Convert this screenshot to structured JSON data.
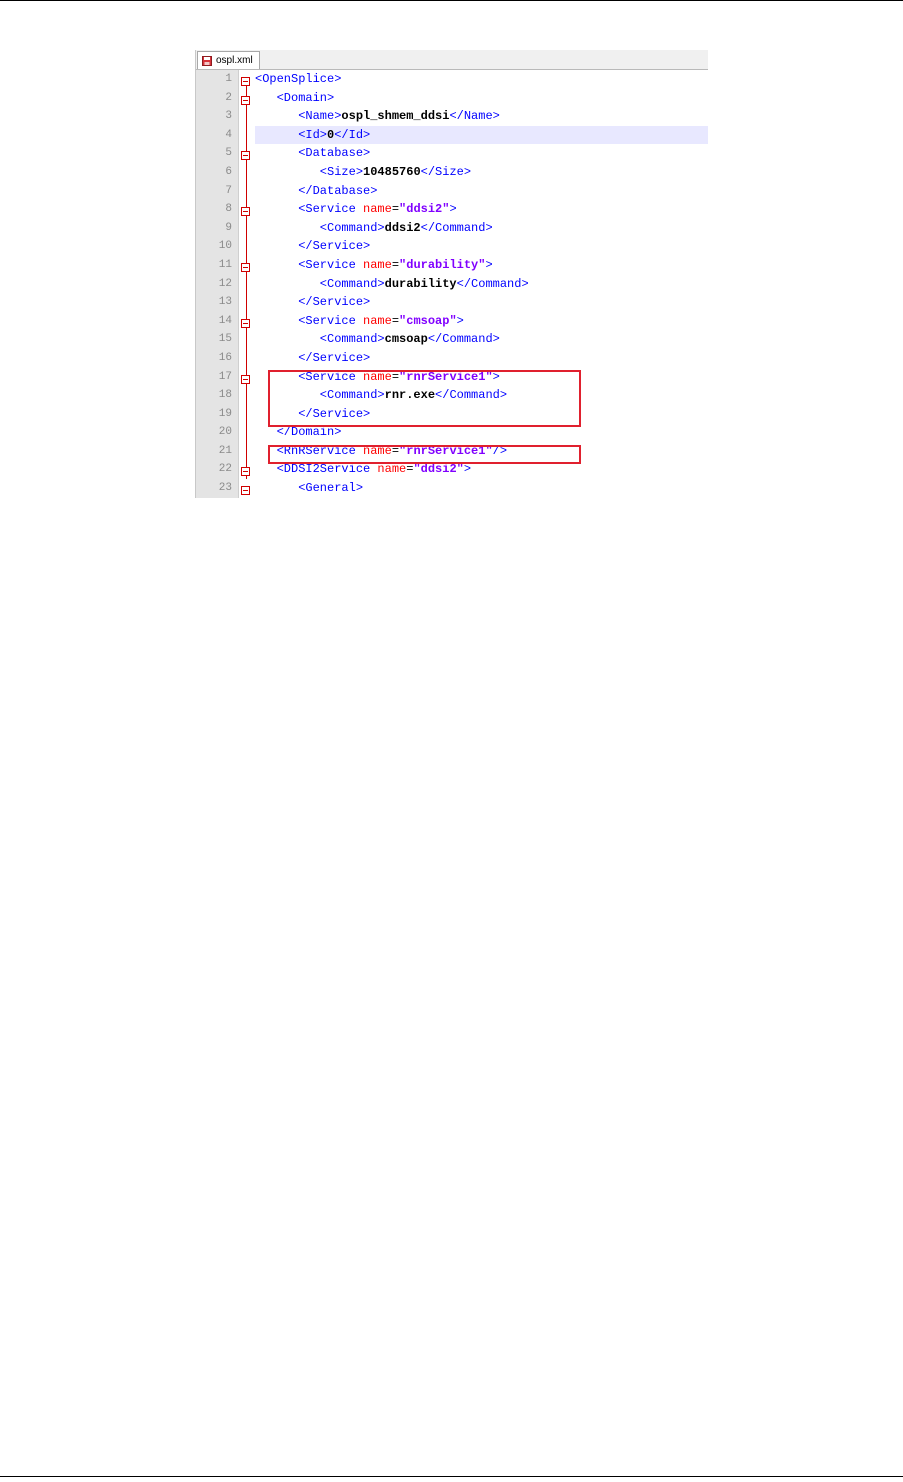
{
  "tab": {
    "filename": "ospl.xml",
    "icon": "save-icon"
  },
  "lines": [
    {
      "num": "1",
      "parts": [
        [
          "tag",
          "<OpenSplice>"
        ]
      ]
    },
    {
      "num": "2",
      "parts": [
        [
          "tag",
          "   <Domain>"
        ]
      ]
    },
    {
      "num": "3",
      "parts": [
        [
          "tag",
          "      <Name>"
        ],
        [
          "txt",
          "ospl_shmem_ddsi"
        ],
        [
          "tag",
          "</Name>"
        ]
      ]
    },
    {
      "num": "4",
      "parts": [
        [
          "tag",
          "      <Id>"
        ],
        [
          "txt",
          "0"
        ],
        [
          "tag",
          "</Id>"
        ]
      ]
    },
    {
      "num": "5",
      "parts": [
        [
          "tag",
          "      <Database>"
        ]
      ]
    },
    {
      "num": "6",
      "parts": [
        [
          "tag",
          "         <Size>"
        ],
        [
          "txt",
          "10485760"
        ],
        [
          "tag",
          "</Size>"
        ]
      ]
    },
    {
      "num": "7",
      "parts": [
        [
          "tag",
          "      </Database>"
        ]
      ]
    },
    {
      "num": "8",
      "parts": [
        [
          "tag",
          "      <Service "
        ],
        [
          "attr",
          "name"
        ],
        [
          "eq",
          "="
        ],
        [
          "val",
          "\"ddsi2\""
        ],
        [
          "tag",
          ">"
        ]
      ]
    },
    {
      "num": "9",
      "parts": [
        [
          "tag",
          "         <Command>"
        ],
        [
          "txt",
          "ddsi2"
        ],
        [
          "tag",
          "</Command>"
        ]
      ]
    },
    {
      "num": "10",
      "parts": [
        [
          "tag",
          "      </Service>"
        ]
      ]
    },
    {
      "num": "11",
      "parts": [
        [
          "tag",
          "      <Service "
        ],
        [
          "attr",
          "name"
        ],
        [
          "eq",
          "="
        ],
        [
          "val",
          "\"durability\""
        ],
        [
          "tag",
          ">"
        ]
      ]
    },
    {
      "num": "12",
      "parts": [
        [
          "tag",
          "         <Command>"
        ],
        [
          "txt",
          "durability"
        ],
        [
          "tag",
          "</Command>"
        ]
      ]
    },
    {
      "num": "13",
      "parts": [
        [
          "tag",
          "      </Service>"
        ]
      ]
    },
    {
      "num": "14",
      "parts": [
        [
          "tag",
          "      <Service "
        ],
        [
          "attr",
          "name"
        ],
        [
          "eq",
          "="
        ],
        [
          "val",
          "\"cmsoap\""
        ],
        [
          "tag",
          ">"
        ]
      ]
    },
    {
      "num": "15",
      "parts": [
        [
          "tag",
          "         <Command>"
        ],
        [
          "txt",
          "cmsoap"
        ],
        [
          "tag",
          "</Command>"
        ]
      ]
    },
    {
      "num": "16",
      "parts": [
        [
          "tag",
          "      </Service>"
        ]
      ]
    },
    {
      "num": "17",
      "parts": [
        [
          "tag",
          "      <Service "
        ],
        [
          "attr",
          "name"
        ],
        [
          "eq",
          "="
        ],
        [
          "val",
          "\"rnrService1\""
        ],
        [
          "tag",
          ">"
        ]
      ]
    },
    {
      "num": "18",
      "parts": [
        [
          "tag",
          "         <Command>"
        ],
        [
          "txt",
          "rnr.exe"
        ],
        [
          "tag",
          "</Command>"
        ]
      ]
    },
    {
      "num": "19",
      "parts": [
        [
          "tag",
          "      </Service>"
        ]
      ]
    },
    {
      "num": "20",
      "parts": [
        [
          "tag",
          "   </Domain>"
        ]
      ]
    },
    {
      "num": "21",
      "parts": [
        [
          "tag",
          "   <RnRService "
        ],
        [
          "attr",
          "name"
        ],
        [
          "eq",
          "="
        ],
        [
          "val",
          "\"rnrService1\""
        ],
        [
          "tag",
          "/>"
        ]
      ]
    },
    {
      "num": "22",
      "parts": [
        [
          "tag",
          "   <DDSI2Service "
        ],
        [
          "attr",
          "name"
        ],
        [
          "eq",
          "="
        ],
        [
          "val",
          "\"ddsi2\""
        ],
        [
          "tag",
          ">"
        ]
      ]
    },
    {
      "num": "23",
      "parts": [
        [
          "tag",
          "      <General>"
        ]
      ]
    }
  ],
  "current_line": "4",
  "fold_lines": [
    "1",
    "2",
    "5",
    "8",
    "11",
    "14",
    "17",
    "22",
    "23"
  ],
  "colors": {
    "tag": "#0000ff",
    "attribute": "#ff0000",
    "value": "#8000ff",
    "highlight": "#e0202e",
    "current_line": "#e8e8ff",
    "fold_marker": "#d00000"
  }
}
